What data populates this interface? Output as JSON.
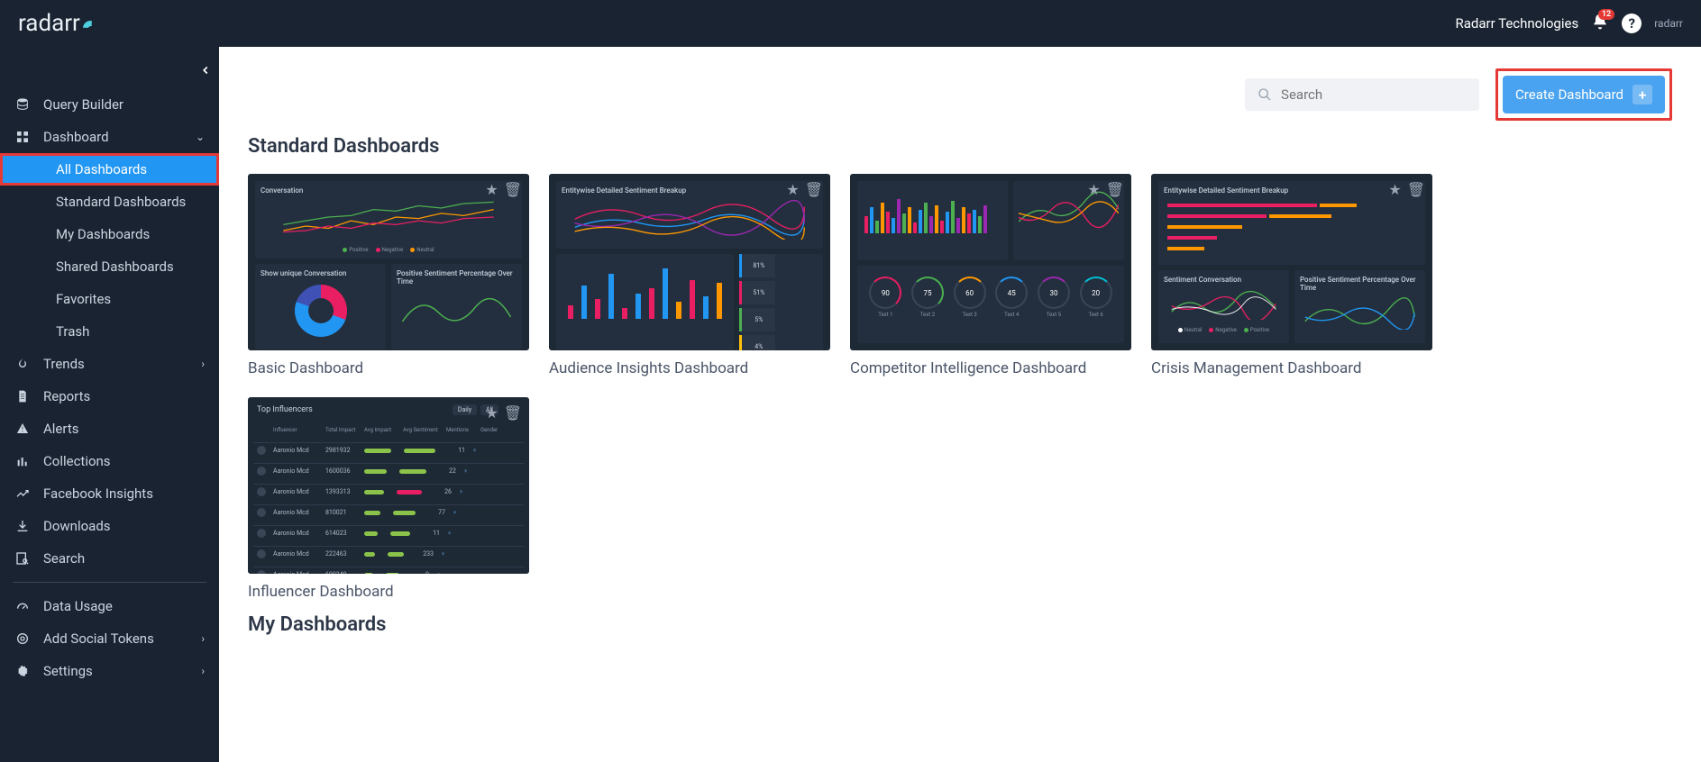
{
  "header": {
    "company": "Radarr Technologies",
    "notification_count": "12",
    "logo_text": "radarr",
    "mini_logo": "radarr"
  },
  "sidebar": {
    "items": [
      {
        "label": "Query Builder"
      },
      {
        "label": "Dashboard",
        "expanded": true,
        "children": [
          {
            "label": "All Dashboards",
            "active": true
          },
          {
            "label": "Standard Dashboards"
          },
          {
            "label": "My Dashboards"
          },
          {
            "label": "Shared Dashboards"
          },
          {
            "label": "Favorites"
          },
          {
            "label": "Trash"
          }
        ]
      },
      {
        "label": "Trends"
      },
      {
        "label": "Reports"
      },
      {
        "label": "Alerts"
      },
      {
        "label": "Collections"
      },
      {
        "label": "Facebook Insights"
      },
      {
        "label": "Downloads"
      },
      {
        "label": "Search"
      }
    ],
    "footer_items": [
      {
        "label": "Data Usage"
      },
      {
        "label": "Add Social Tokens"
      },
      {
        "label": "Settings"
      }
    ]
  },
  "toolbar": {
    "search_placeholder": "Search",
    "create_label": "Create Dashboard"
  },
  "sections": {
    "standard_title": "Standard Dashboards",
    "my_title": "My Dashboards",
    "standard_cards": [
      {
        "title": "Basic Dashboard",
        "panel1": "Conversation",
        "panel2": "Show unique Conversation",
        "panel3": "Positive Sentiment Percentage Over Time",
        "leg1": "Positive",
        "leg2": "Negative",
        "leg3": "Neutral"
      },
      {
        "title": "Audience Insights Dashboard",
        "panel1": "Entitywise Detailed Sentiment Breakup"
      },
      {
        "title": "Competitor Intelligence Dashboard",
        "g1": "90",
        "g2": "75",
        "g3": "60",
        "g4": "45",
        "g5": "30",
        "g6": "20",
        "gl1": "Text 1",
        "gl2": "Text 2",
        "gl3": "Text 3",
        "gl4": "Text 4",
        "gl5": "Text 5",
        "gl6": "Text 6"
      },
      {
        "title": "Crisis Management Dashboard",
        "panel1": "Entitywise Detailed Sentiment Breakup",
        "panel2": "Sentiment Conversation",
        "panel3": "Positive Sentiment Percentage Over Time",
        "leg1": "Neutral",
        "leg2": "Negative",
        "leg3": "Positive"
      },
      {
        "title": "Influencer Dashboard",
        "panel1": "Top Influencers",
        "opt1": "Daily",
        "opt2": "All",
        "th1": "Influencer",
        "th2": "Total Impact",
        "th3": "Avg Impact",
        "th4": "Avg Sentiment",
        "th5": "Mentions",
        "th6": "Gender"
      }
    ]
  }
}
